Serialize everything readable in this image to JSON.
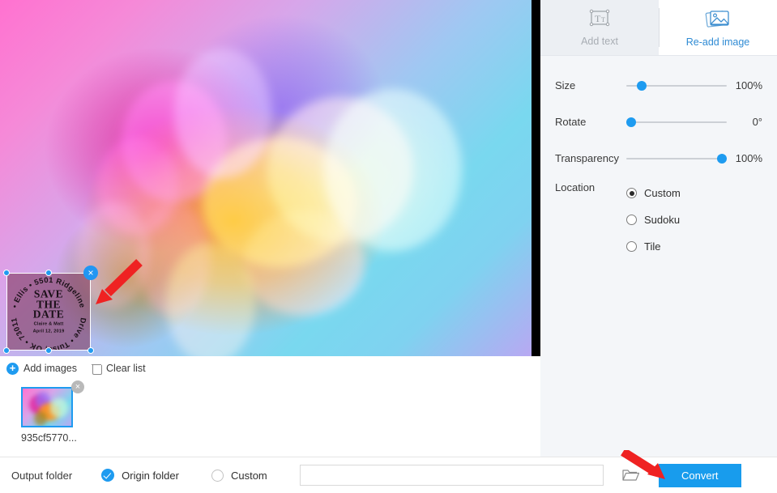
{
  "tabs": [
    {
      "label": "Add text",
      "icon": "add-text-icon",
      "active": false
    },
    {
      "label": "Re-add image",
      "icon": "image-stack-icon",
      "active": true
    }
  ],
  "settings": {
    "sliders": [
      {
        "name": "size",
        "label": "Size",
        "value": "100%",
        "thumb_pct": 12
      },
      {
        "name": "rotate",
        "label": "Rotate",
        "value": "0°",
        "thumb_pct": 0
      },
      {
        "name": "transparency",
        "label": "Transparency",
        "value": "100%",
        "thumb_pct": 100
      }
    ],
    "location": {
      "label": "Location",
      "options": [
        {
          "label": "Custom",
          "checked": true
        },
        {
          "label": "Sudoku",
          "checked": false
        },
        {
          "label": "Tile",
          "checked": false
        }
      ]
    }
  },
  "list_toolbar": {
    "add_images": "Add images",
    "clear_list": "Clear list"
  },
  "thumbnail": {
    "filename": "935cf5770...",
    "close_glyph": "×"
  },
  "watermark": {
    "line1": "SAVE",
    "line2": "THE",
    "line3": "DATE",
    "names": "Claire & Matt",
    "date": "April 12, 2019",
    "ring_top": "• Ellis • 5501 Ridgeline",
    "ring_bottom": "Drive • Tulsa, OK • 73011",
    "close_glyph": "×"
  },
  "bottom_bar": {
    "output_label": "Output folder",
    "origin_option": "Origin folder",
    "custom_option": "Custom",
    "path_value": "",
    "path_placeholder": "",
    "browse_icon": "folder-icon",
    "convert_label": "Convert"
  },
  "colors": {
    "accent": "#189ced",
    "accent_light": "#1e9bf0",
    "tab_active_text": "#2f8bd4",
    "tab_inactive_bg": "#eceff3",
    "panel_bg": "#f4f6f9",
    "annotation_arrow": "#ef2222"
  }
}
